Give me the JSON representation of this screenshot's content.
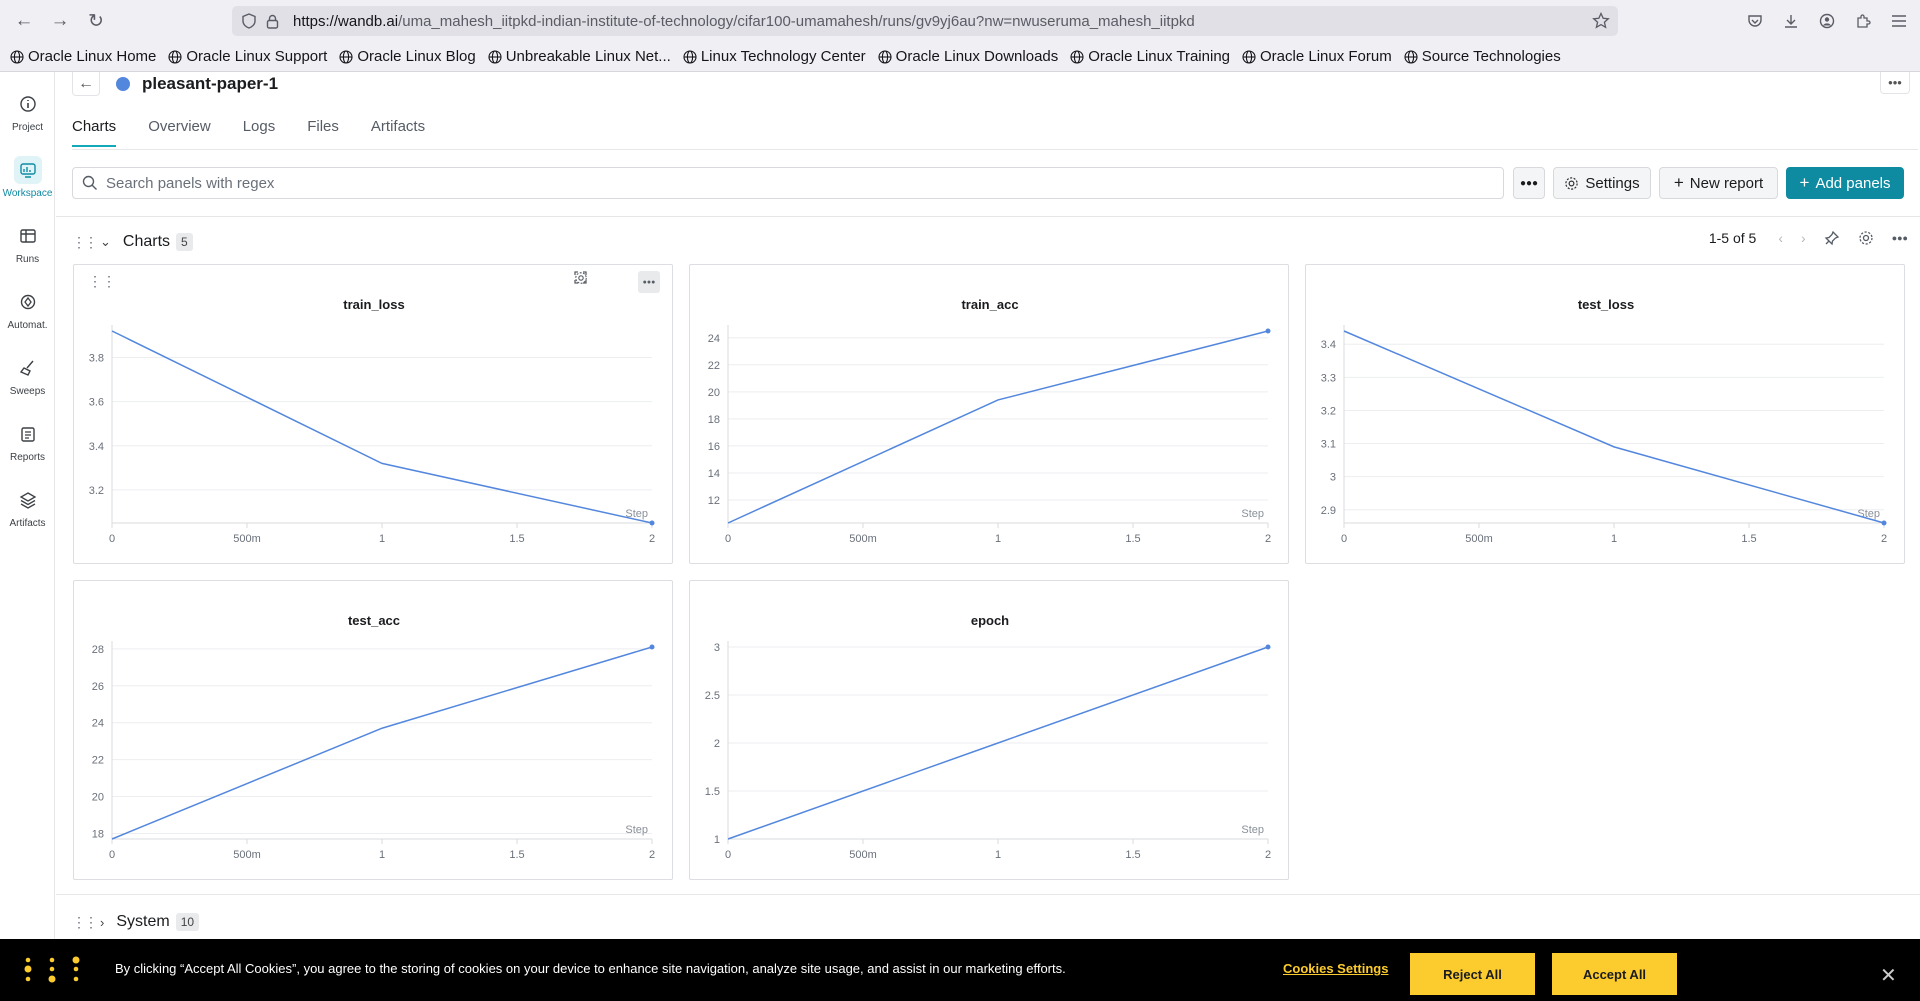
{
  "browser": {
    "url_host": "https://wandb.ai",
    "url_path": "/uma_mahesh_iitpkd-indian-institute-of-technology/cifar100-umamahesh/runs/gv9yj6au?nw=nwuseruma_mahesh_iitpkd",
    "bookmarks": [
      "Oracle Linux Home",
      "Oracle Linux Support",
      "Oracle Linux Blog",
      "Unbreakable Linux Net...",
      "Linux Technology Center",
      "Oracle Linux Downloads",
      "Oracle Linux Training",
      "Oracle Linux Forum",
      "Source Technologies"
    ]
  },
  "rail": {
    "items": [
      {
        "label": "Project",
        "icon": "info-icon"
      },
      {
        "label": "Workspace",
        "icon": "workspace-icon",
        "active": true
      },
      {
        "label": "Runs",
        "icon": "table-icon"
      },
      {
        "label": "Automat.",
        "icon": "automation-icon"
      },
      {
        "label": "Sweeps",
        "icon": "broom-icon"
      },
      {
        "label": "Reports",
        "icon": "clipboard-icon"
      },
      {
        "label": "Artifacts",
        "icon": "layers-icon"
      }
    ]
  },
  "run": {
    "name": "pleasant-paper-1",
    "color": "#5387dd"
  },
  "tabs": [
    "Charts",
    "Overview",
    "Logs",
    "Files",
    "Artifacts"
  ],
  "toolbar": {
    "search_placeholder": "Search panels with regex",
    "settings_label": "Settings",
    "new_report_label": "New report",
    "add_panels_label": "Add panels"
  },
  "section": {
    "title": "Charts",
    "count": "5",
    "pager": "1-5 of 5"
  },
  "system": {
    "title": "System",
    "count": "10"
  },
  "colors": {
    "accent": "#0e8ba1",
    "line": "#5387dd",
    "cookie_yellow": "#fccc2f"
  },
  "chart_data": [
    {
      "type": "line",
      "title": "train_loss",
      "xlabel": "Step",
      "x": [
        0,
        1,
        2
      ],
      "x_ticks": [
        "0",
        "500m",
        "1",
        "1.5",
        "2"
      ],
      "y_ticks": [
        "3.2",
        "3.4",
        "3.6",
        "3.8"
      ],
      "series": [
        {
          "values": [
            3.92,
            3.32,
            3.05
          ]
        }
      ],
      "xlim": [
        0,
        2
      ],
      "ylim": [
        3.05,
        3.92
      ]
    },
    {
      "type": "line",
      "title": "train_acc",
      "xlabel": "Step",
      "x": [
        0,
        1,
        2
      ],
      "x_ticks": [
        "0",
        "500m",
        "1",
        "1.5",
        "2"
      ],
      "y_ticks": [
        "12",
        "14",
        "16",
        "18",
        "20",
        "22",
        "24"
      ],
      "series": [
        {
          "values": [
            10.3,
            19.4,
            24.5
          ]
        }
      ],
      "xlim": [
        0,
        2
      ],
      "ylim": [
        10.3,
        24.5
      ]
    },
    {
      "type": "line",
      "title": "test_loss",
      "xlabel": "Step",
      "x": [
        0,
        1,
        2
      ],
      "x_ticks": [
        "0",
        "500m",
        "1",
        "1.5",
        "2"
      ],
      "y_ticks": [
        "2.9",
        "3",
        "3.1",
        "3.2",
        "3.3",
        "3.4"
      ],
      "series": [
        {
          "values": [
            3.44,
            3.09,
            2.86
          ]
        }
      ],
      "xlim": [
        0,
        2
      ],
      "ylim": [
        2.86,
        3.44
      ]
    },
    {
      "type": "line",
      "title": "test_acc",
      "xlabel": "Step",
      "x": [
        0,
        1,
        2
      ],
      "x_ticks": [
        "0",
        "500m",
        "1",
        "1.5",
        "2"
      ],
      "y_ticks": [
        "18",
        "20",
        "22",
        "24",
        "26",
        "28"
      ],
      "series": [
        {
          "values": [
            17.7,
            23.7,
            28.1
          ]
        }
      ],
      "xlim": [
        0,
        2
      ],
      "ylim": [
        17.7,
        28.1
      ]
    },
    {
      "type": "line",
      "title": "epoch",
      "xlabel": "Step",
      "x": [
        0,
        1,
        2
      ],
      "x_ticks": [
        "0",
        "500m",
        "1",
        "1.5",
        "2"
      ],
      "y_ticks": [
        "1",
        "1.5",
        "2",
        "2.5",
        "3"
      ],
      "series": [
        {
          "values": [
            1,
            2,
            3
          ]
        }
      ],
      "xlim": [
        0,
        2
      ],
      "ylim": [
        1,
        3
      ]
    }
  ],
  "cookie": {
    "text": "By clicking “Accept All Cookies”, you agree to the storing of cookies on your device to enhance site navigation, analyze site usage, and assist in our marketing efforts.",
    "settings_label": "Cookies Settings",
    "reject_label": "Reject All",
    "accept_label": "Accept All"
  }
}
